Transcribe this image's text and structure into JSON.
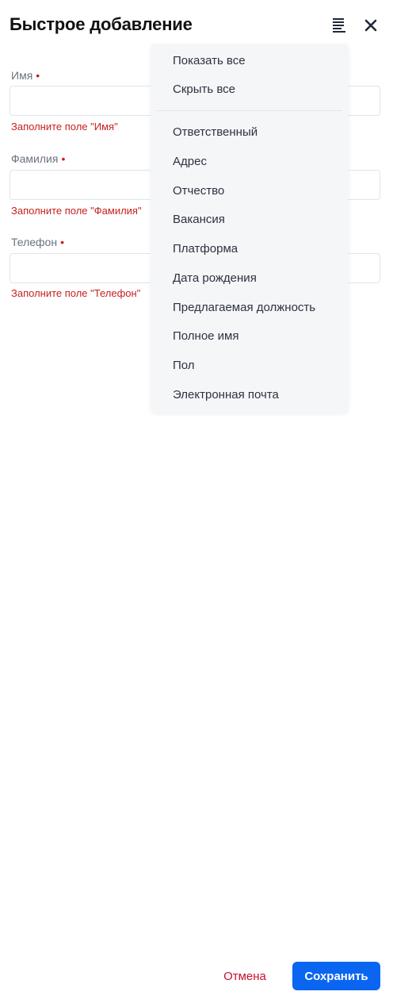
{
  "header": {
    "title": "Быстрое добавление",
    "fields_icon": "fields-list-icon",
    "close_icon": "close-icon"
  },
  "form": {
    "fields": [
      {
        "label": "Имя",
        "required_mark": "•",
        "value": "",
        "error": "Заполните поле \"Имя\""
      },
      {
        "label": "Фамилия",
        "required_mark": "•",
        "value": "",
        "error": "Заполните поле \"Фамилия\""
      },
      {
        "label": "Телефон",
        "required_mark": "•",
        "value": "",
        "error": "Заполните поле \"Телефон\""
      }
    ]
  },
  "fields_menu": {
    "actions": [
      "Показать все",
      "Скрыть все"
    ],
    "items": [
      "Ответственный",
      "Адрес",
      "Отчество",
      "Вакансия",
      "Платформа",
      "Дата рождения",
      "Предлагаемая должность",
      "Полное имя",
      "Пол",
      "Электронная почта"
    ]
  },
  "footer": {
    "cancel_label": "Отмена",
    "save_label": "Сохранить"
  },
  "colors": {
    "accent": "#0a66f0",
    "error": "#c81e1e",
    "cancel": "#c8102e"
  }
}
